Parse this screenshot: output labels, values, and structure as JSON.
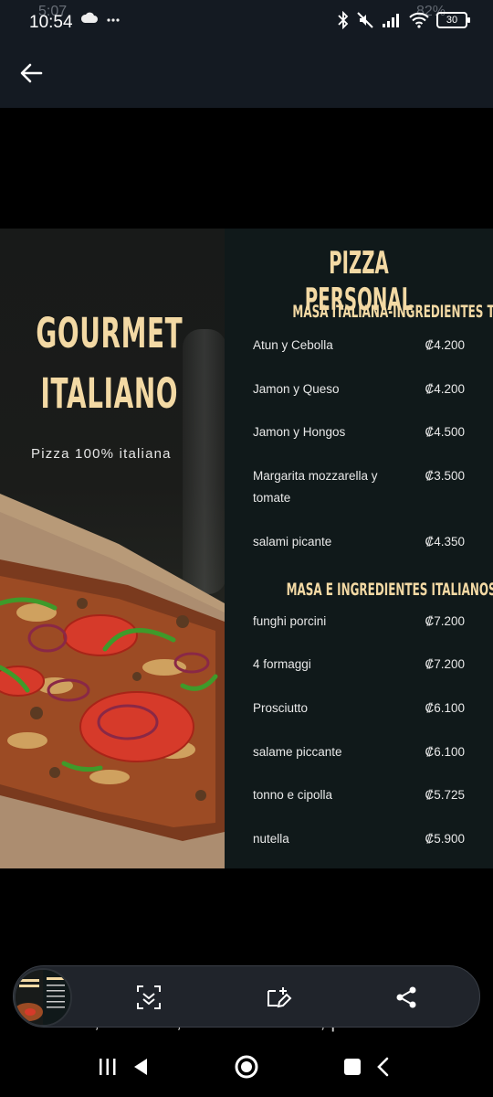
{
  "status_bar": {
    "time": "10:54",
    "ghost_time": "5:07",
    "battery": "30",
    "ghost_battery": "82%",
    "notif_icons": [
      "cloud-icon",
      "dots-icon"
    ],
    "right_icons": [
      "bluetooth-icon",
      "mute-icon",
      "signal-icon",
      "wifi-icon",
      "battery-icon"
    ]
  },
  "app_bar": {
    "back_icon": "arrow-left-icon"
  },
  "image": {
    "brand_title_line1": "GOURMET",
    "brand_title_line2": "ITALIANO",
    "brand_subtitle": "Pizza 100% italiana",
    "heading": "PIZZA PERSONAL",
    "sections": [
      {
        "title": "MASA ITALIANA-INGREDIENTES TICOS",
        "items": [
          {
            "name": "Atun y Cebolla",
            "price": "₡4.200"
          },
          {
            "name": "Jamon y Queso",
            "price": "₡4.200"
          },
          {
            "name": "Jamon y Hongos",
            "price": "₡4.500"
          },
          {
            "name": "Margarita mozzarella y tomate",
            "price": "₡3.500"
          },
          {
            "name": "salami picante",
            "price": "₡4.350"
          }
        ]
      },
      {
        "title": "MASA E INGREDIENTES ITALIANOS",
        "items": [
          {
            "name": "funghi porcini",
            "price": "₡7.200"
          },
          {
            "name": "4 formaggi",
            "price": "₡7.200"
          },
          {
            "name": "Prosciutto",
            "price": "₡6.100"
          },
          {
            "name": "salame piccante",
            "price": "₡6.100"
          },
          {
            "name": "tonno e cipolla",
            "price": "₡5.725"
          },
          {
            "name": "nutella",
            "price": "₡5.900"
          }
        ]
      }
    ]
  },
  "toolbar": {
    "buttons": [
      "scan-icon",
      "edit-image-icon",
      "share-icon"
    ]
  },
  "caption_peek": "Pizza , calzone , comida italiana , pasta",
  "nav_bar": {
    "buttons": [
      "recents-icon",
      "back-triangle-icon",
      "home-icon",
      "square-icon",
      "chevron-back-icon"
    ]
  },
  "colors": {
    "gold": "#f3d9a4",
    "panel": "#10191a",
    "topbar": "#141a22"
  }
}
